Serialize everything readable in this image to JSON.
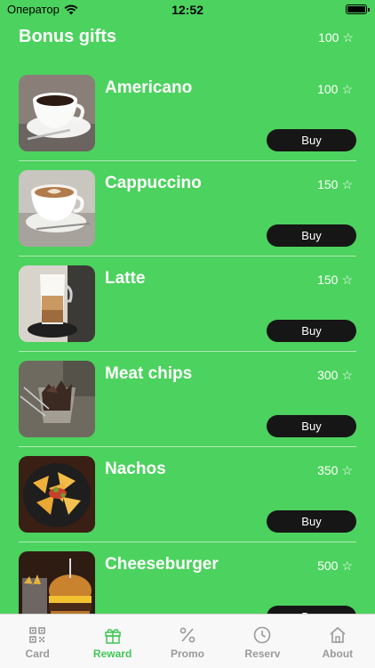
{
  "status": {
    "carrier": "Оператор",
    "time": "12:52"
  },
  "header": {
    "title": "Bonus gifts",
    "points": "100"
  },
  "items": [
    {
      "name": "Americano",
      "price": "100",
      "buy_label": "Buy"
    },
    {
      "name": "Cappuccino",
      "price": "150",
      "buy_label": "Buy"
    },
    {
      "name": "Latte",
      "price": "150",
      "buy_label": "Buy"
    },
    {
      "name": "Meat chips",
      "price": "300",
      "buy_label": "Buy"
    },
    {
      "name": "Nachos",
      "price": "350",
      "buy_label": "Buy"
    },
    {
      "name": "Cheeseburger",
      "price": "500",
      "buy_label": "Buy"
    }
  ],
  "tabs": [
    {
      "label": "Card",
      "icon": "qr-code-icon"
    },
    {
      "label": "Reward",
      "icon": "gift-icon"
    },
    {
      "label": "Promo",
      "icon": "percent-icon"
    },
    {
      "label": "Reserv",
      "icon": "clock-icon"
    },
    {
      "label": "About",
      "icon": "home-icon"
    }
  ],
  "active_tab": "Reward",
  "colors": {
    "background": "#4cd25e",
    "buy_button": "#161616",
    "active_tab": "#42c654",
    "inactive_tab": "#9a9a9a"
  }
}
